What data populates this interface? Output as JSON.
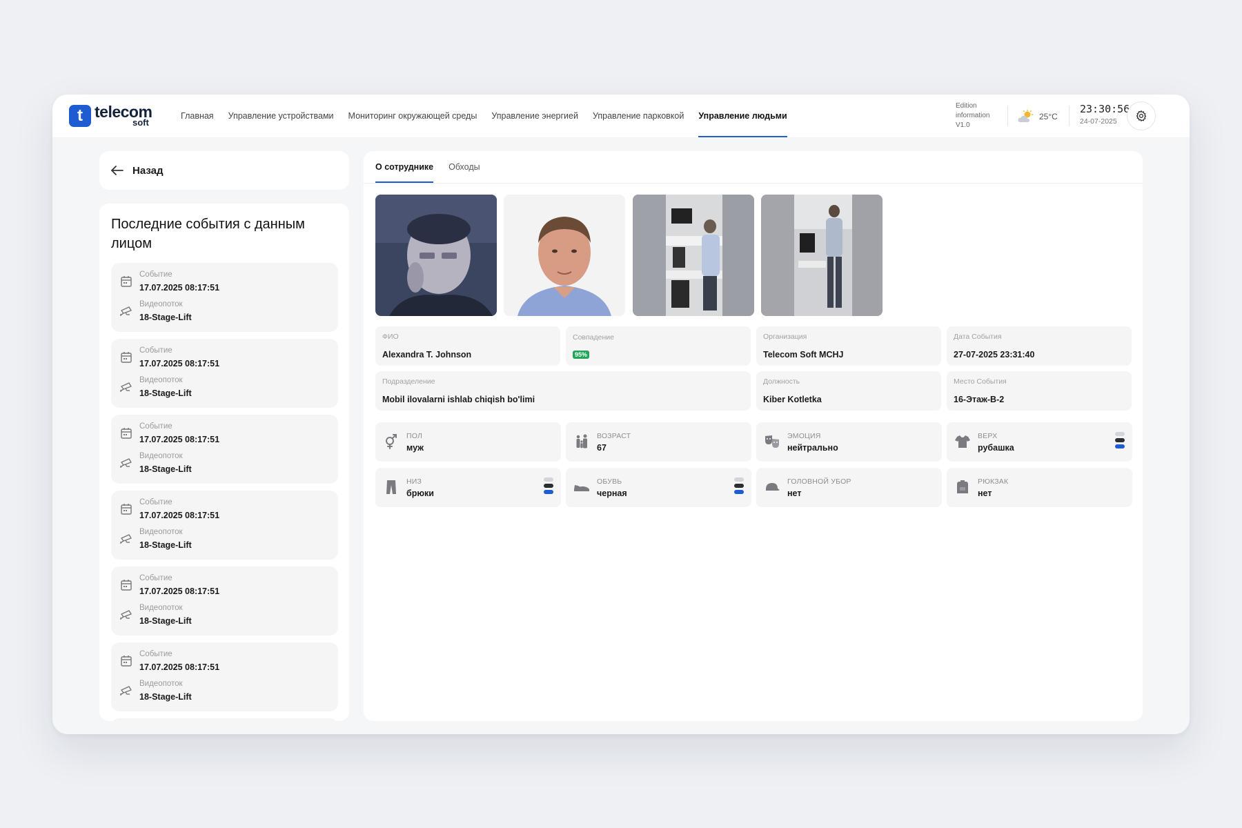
{
  "logo": {
    "word": "telecom",
    "sub": "soft",
    "mark": "t"
  },
  "nav": {
    "items": [
      {
        "label": "Главная"
      },
      {
        "label": "Управление устройствами"
      },
      {
        "label": "Мониторинг окружающей среды"
      },
      {
        "label": "Управление энергией"
      },
      {
        "label": "Управление парковкой"
      },
      {
        "label": "Управление людьми"
      }
    ],
    "active_index": 5
  },
  "header": {
    "edition_line1": "Edition",
    "edition_line2": "information",
    "edition_line3": "V1.0",
    "weather_temp": "25°C",
    "clock_time": "23:30:56",
    "clock_date": "24-07-2025",
    "settings_icon": "gear-icon"
  },
  "back": {
    "label": "Назад",
    "icon": "arrow-left-icon"
  },
  "events": {
    "title": "Последние события с данным лицом",
    "event_label": "Событие",
    "stream_label": "Видеопоток",
    "items": [
      {
        "datetime": "17.07.2025 08:17:51",
        "stream": "18-Stage-Lift"
      },
      {
        "datetime": "17.07.2025 08:17:51",
        "stream": "18-Stage-Lift"
      },
      {
        "datetime": "17.07.2025 08:17:51",
        "stream": "18-Stage-Lift"
      },
      {
        "datetime": "17.07.2025 08:17:51",
        "stream": "18-Stage-Lift"
      },
      {
        "datetime": "17.07.2025 08:17:51",
        "stream": "18-Stage-Lift"
      },
      {
        "datetime": "17.07.2025 08:17:51",
        "stream": "18-Stage-Lift"
      }
    ]
  },
  "tabs": [
    {
      "label": "О сотруднике",
      "active": true
    },
    {
      "label": "Обходы",
      "active": false
    }
  ],
  "details": {
    "fio_label": "ФИО",
    "fio": "Alexandra T. Johnson",
    "match_label": "Совпадение",
    "match": "95%",
    "org_label": "Организация",
    "org": "Telecom Soft MCHJ",
    "event_date_label": "Дата События",
    "event_date": "27-07-2025 23:31:40",
    "dept_label": "Подразделение",
    "dept": "Mobil ilovalarni ishlab chiqish bo'limi",
    "position_label": "Должность",
    "position": "Kiber Kotletka",
    "place_label": "Место События",
    "place": "16-Этаж-B-2"
  },
  "attributes": {
    "gender_label": "пол",
    "gender": "муж",
    "age_label": "возраст",
    "age": "67",
    "emotion_label": "эмоция",
    "emotion": "нейтрально",
    "top_label": "верх",
    "top": "рубашка",
    "bottom_label": "низ",
    "bottom": "брюки",
    "shoes_label": "обувь",
    "shoes": "черная",
    "headwear_label": "головной убор",
    "headwear": "нет",
    "backpack_label": "рюкзак",
    "backpack": "нет"
  },
  "colors": {
    "accent": "#1f5bd1",
    "match_badge": "#22a45a",
    "chip_light": "#d3d5da",
    "chip_dark": "#2b2d33",
    "chip_blue": "#1f5bd1"
  }
}
